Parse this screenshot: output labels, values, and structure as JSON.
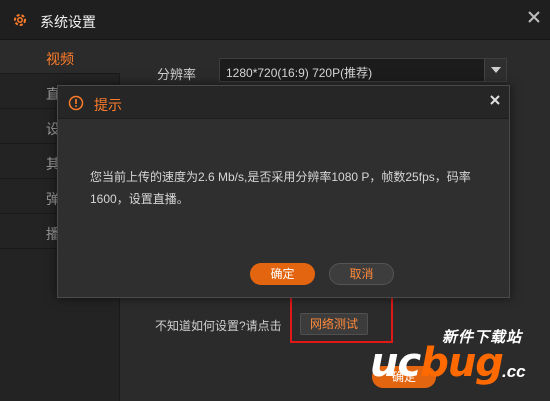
{
  "window": {
    "title": "系统设置",
    "icon": "gear-icon",
    "close_icon": "close-icon"
  },
  "sidebar": {
    "items": [
      {
        "label": "视频",
        "active": true
      },
      {
        "label": "直",
        "active": false
      },
      {
        "label": "设",
        "active": false
      },
      {
        "label": "其",
        "active": false
      },
      {
        "label": "弹",
        "active": false
      },
      {
        "label": "播",
        "active": false
      }
    ]
  },
  "video": {
    "resolution_label": "分辨率",
    "resolution_value": "1280*720(16:9) 720P(推荐)"
  },
  "help": {
    "hint": "不知道如何设置?请点击",
    "network_test_button": "网络测试"
  },
  "footer": {
    "ok_label": "确定"
  },
  "dialog": {
    "title": "提示",
    "message": "您当前上传的速度为2.6 Mb/s,是否采用分辨率1080 P，帧数25fps，码率1600，设置直播。",
    "ok_label": "确定",
    "cancel_label": "取消"
  },
  "watermark": {
    "top_text": "新件下载站",
    "logo_main": "uc",
    "logo_accent": "bug",
    "logo_suffix": ".cc"
  },
  "colors": {
    "accent": "#ff7d2a",
    "primary_button": "#e4650f",
    "highlight_box": "#e01818",
    "background": "#2b2b2b"
  }
}
